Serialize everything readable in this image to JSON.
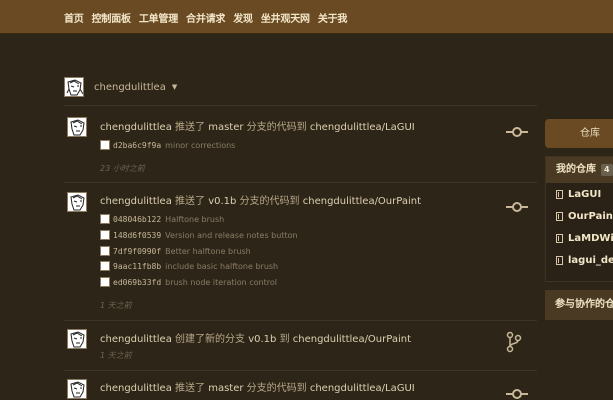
{
  "nav": [
    "首页",
    "控制面板",
    "工单管理",
    "合并请求",
    "发现",
    "坐井观天网",
    "关于我"
  ],
  "context": {
    "user": "chengdulittlea"
  },
  "feed": [
    {
      "user": "chengdulittlea",
      "action": "推送了",
      "branch": "master",
      "mid": "分支的代码到",
      "repo": "chengdulittlea/LaGUI",
      "icon": "commit-icon",
      "commits": [
        {
          "sha": "d2ba6c9f9a",
          "message": "minor corrections"
        }
      ],
      "time": "23 小时之前"
    },
    {
      "user": "chengdulittlea",
      "action": "推送了",
      "branch": "v0.1b",
      "mid": "分支的代码到",
      "repo": "chengdulittlea/OurPaint",
      "icon": "commit-icon",
      "commits": [
        {
          "sha": "048046b122",
          "message": "Halftone brush"
        },
        {
          "sha": "148d6f0539",
          "message": "Version and release notes button"
        },
        {
          "sha": "7df9f0990f",
          "message": "Better halftone brush"
        },
        {
          "sha": "9aac11fb8b",
          "message": "include basic halftone brush"
        },
        {
          "sha": "ed069b33fd",
          "message": "brush node iteration control"
        }
      ],
      "time": "1 天之前"
    },
    {
      "user": "chengdulittlea",
      "action": "创建了新的分支",
      "branch": "v0.1b",
      "mid": "到",
      "repo": "chengdulittlea/OurPaint",
      "icon": "branch-icon",
      "commits": [],
      "time": "1 天之前"
    },
    {
      "user": "chengdulittlea",
      "action": "推送了",
      "branch": "master",
      "mid": "分支的代码到",
      "repo": "chengdulittlea/LaGUI",
      "icon": "commit-icon",
      "commits": [],
      "time": ""
    }
  ],
  "sidebar": {
    "repo_tab": "仓库",
    "my_repos_title": "我的仓库",
    "my_repos_count": "4",
    "repos": [
      "LaGUI",
      "OurPaint",
      "LaMDWiki",
      "lagui_demo"
    ],
    "collab_title": "参与协作的仓库"
  }
}
